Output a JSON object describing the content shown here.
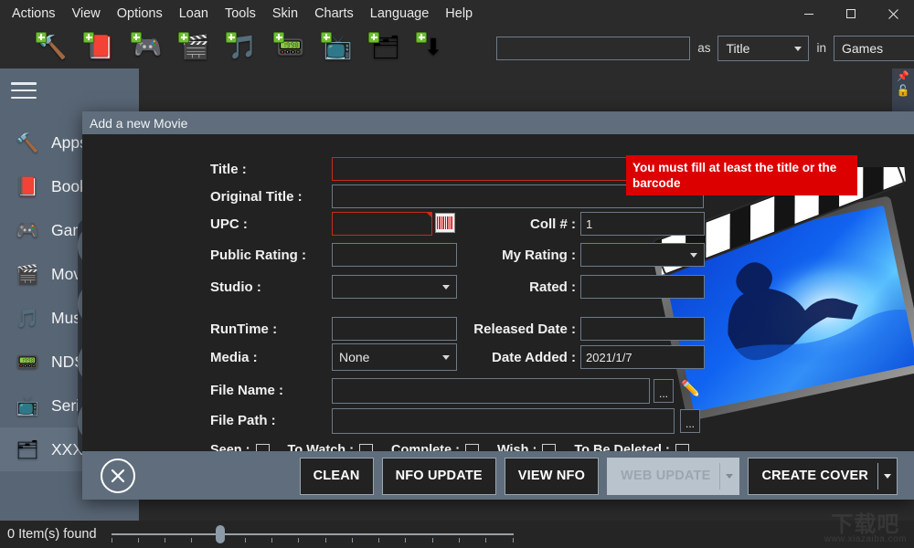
{
  "menubar": {
    "items": [
      {
        "label": "Actions"
      },
      {
        "label": "View"
      },
      {
        "label": "Options"
      },
      {
        "label": "Loan"
      },
      {
        "label": "Tools"
      },
      {
        "label": "Skin"
      },
      {
        "label": "Charts"
      },
      {
        "label": "Language"
      },
      {
        "label": "Help"
      }
    ]
  },
  "window_controls": {
    "minimize": "minimize-icon",
    "maximize": "maximize-icon",
    "close": "close-icon"
  },
  "toolbar": {
    "buttons": [
      {
        "name": "add-apps",
        "icon": "tools-icon",
        "glyph": "🔨"
      },
      {
        "name": "add-books",
        "icon": "book-icon",
        "glyph": "📕"
      },
      {
        "name": "add-games",
        "icon": "gamepad-icon",
        "glyph": "🎮"
      },
      {
        "name": "add-movies",
        "icon": "clapperboard-icon",
        "glyph": "🎬"
      },
      {
        "name": "add-music",
        "icon": "music-note-icon",
        "glyph": "🎵"
      },
      {
        "name": "add-nds",
        "icon": "handheld-console-icon",
        "glyph": "📟"
      },
      {
        "name": "add-series",
        "icon": "television-icon",
        "glyph": "📺"
      },
      {
        "name": "add-xxx",
        "icon": "x-folder-icon",
        "glyph": "🗂"
      },
      {
        "name": "import",
        "icon": "download-icon",
        "glyph": "⬇"
      }
    ]
  },
  "search": {
    "value": "",
    "placeholder": "",
    "as_label": "as",
    "as_value": "Title",
    "in_label": "in",
    "in_value": "Games"
  },
  "sidebar": {
    "menu_button": "hamburger-icon",
    "items": [
      {
        "label": "Apps",
        "icon": "tools-icon",
        "glyph": "🔨"
      },
      {
        "label": "Books",
        "icon": "book-icon",
        "glyph": "📕"
      },
      {
        "label": "Games",
        "icon": "gamepad-icon",
        "glyph": "🎮"
      },
      {
        "label": "Movies",
        "icon": "clapperboard-icon",
        "glyph": "🎬"
      },
      {
        "label": "Music",
        "icon": "music-note-icon",
        "glyph": "🎵"
      },
      {
        "label": "NDS",
        "icon": "handheld-console-icon",
        "glyph": "📟"
      },
      {
        "label": "Series",
        "icon": "television-icon",
        "glyph": "📺"
      },
      {
        "label": "XXX",
        "icon": "x-folder-icon",
        "glyph": "🗂"
      }
    ]
  },
  "panel_icons": {
    "pin": "pin-icon",
    "lock": "unlocked-padlock-icon"
  },
  "dialog": {
    "title": "Add a new Movie",
    "fields": {
      "title": {
        "label": "Title :",
        "value": "",
        "error": true
      },
      "original_title": {
        "label": "Original Title :",
        "value": ""
      },
      "upc": {
        "label": "UPC :",
        "value": "",
        "error": true
      },
      "public_rating": {
        "label": "Public Rating :",
        "value": ""
      },
      "studio": {
        "label": "Studio :",
        "value": ""
      },
      "runtime": {
        "label": "RunTime :",
        "value": ""
      },
      "media": {
        "label": "Media :",
        "value": "None"
      },
      "file_name": {
        "label": "File Name :",
        "value": ""
      },
      "file_path": {
        "label": "File Path :",
        "value": ""
      },
      "coll_num": {
        "label": "Coll # :",
        "value": "1"
      },
      "my_rating": {
        "label": "My Rating :",
        "value": ""
      },
      "rated": {
        "label": "Rated :",
        "value": ""
      },
      "released_date": {
        "label": "Released Date :",
        "value": ""
      },
      "date_added": {
        "label": "Date Added :",
        "value": "2021/1/7"
      }
    },
    "barcode_button": "barcode-scan-icon",
    "file_name_browse": "...",
    "file_name_edit": "pencil-icon",
    "file_path_browse": "...",
    "checkboxes": [
      {
        "label": "Seen :",
        "checked": false
      },
      {
        "label": "To Watch :",
        "checked": false
      },
      {
        "label": "Complete :",
        "checked": false
      },
      {
        "label": "Wish :",
        "checked": false
      },
      {
        "label": "To Be Deleted :",
        "checked": false
      }
    ],
    "error_message": "You must fill at least the title or the barcode",
    "close_button": "close-icon",
    "buttons": [
      {
        "label": "CLEAN",
        "split": false,
        "disabled": false
      },
      {
        "label": "NFO UPDATE",
        "split": false,
        "disabled": false
      },
      {
        "label": "VIEW NFO",
        "split": false,
        "disabled": false
      },
      {
        "label": "WEB UPDATE",
        "split": true,
        "disabled": true
      },
      {
        "label": "CREATE COVER",
        "split": true,
        "disabled": false
      }
    ],
    "poster_image": "movie-clapperboard-poster"
  },
  "statusbar": {
    "item_count_text": "0 Item(s) found",
    "zoom_value": 4,
    "zoom_min": 0,
    "zoom_max": 15
  },
  "watermark": {
    "text": "下载吧",
    "url": "www.xiazaiba.com"
  },
  "colors": {
    "window_bg": "#2b2b2b",
    "sidebar_bg": "#586574",
    "dialog_bg": "#222222",
    "dialog_title_bg": "#5f6d7c",
    "error_red": "#dd0000",
    "field_border": "#6d7a86",
    "accent_text": "#f0f0f0"
  }
}
